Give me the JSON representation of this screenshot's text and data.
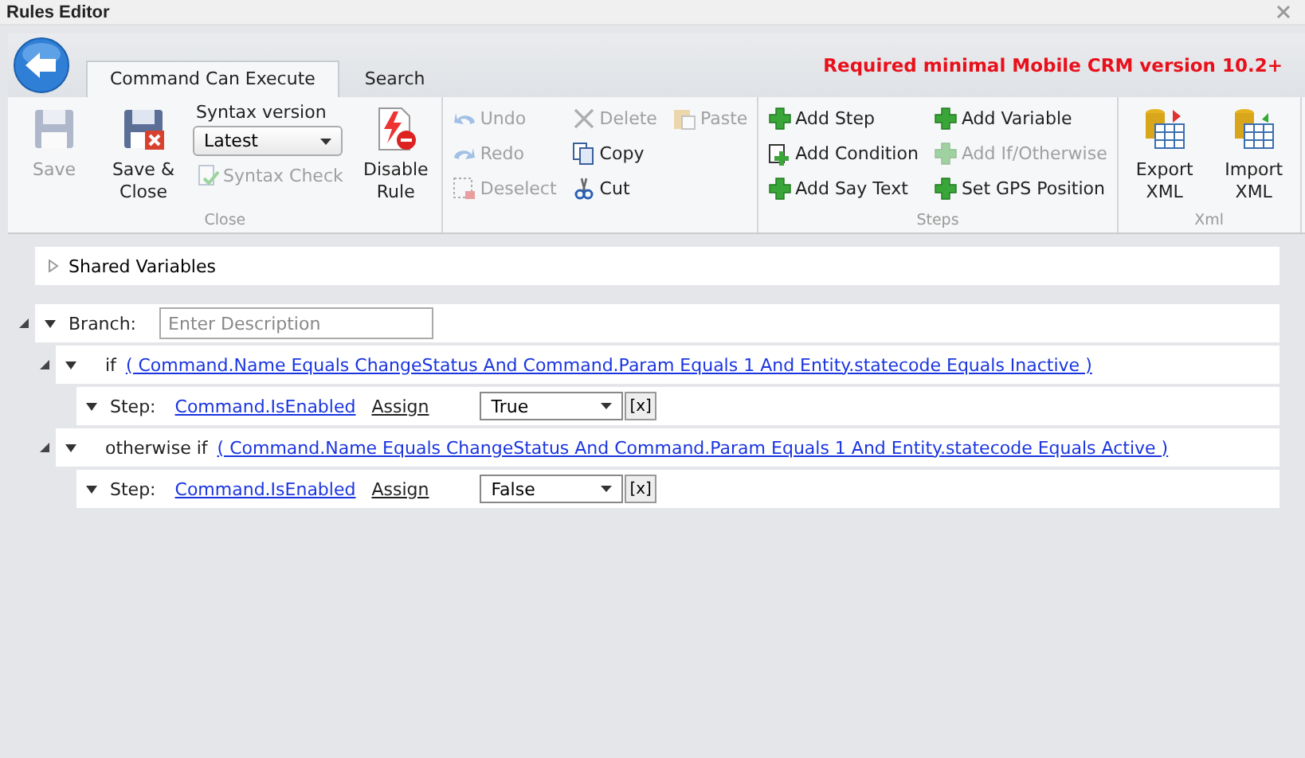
{
  "window": {
    "title": "Rules Editor"
  },
  "tabs": [
    {
      "label": "Command Can Execute",
      "selected": true
    },
    {
      "label": "Search",
      "selected": false
    }
  ],
  "notice": "Required minimal Mobile CRM version 10.2+",
  "ribbon_groups": [
    {
      "label": "Close",
      "columns": [
        [
          {
            "kind": "large",
            "label": "Save",
            "disabled": true
          }
        ],
        [
          {
            "kind": "large",
            "label": "Save & Close",
            "disabled": false
          }
        ],
        [
          {
            "kind": "caption",
            "label": "Syntax version"
          },
          {
            "kind": "select",
            "value": "Latest"
          },
          {
            "kind": "small",
            "label": "Syntax Check",
            "disabled": true
          }
        ],
        [
          {
            "kind": "large",
            "label": "Disable Rule",
            "disabled": false
          }
        ]
      ]
    },
    {
      "columns": [
        [
          {
            "kind": "small",
            "label": "Undo",
            "disabled": true
          },
          {
            "kind": "small",
            "label": "Redo",
            "disabled": true
          },
          {
            "kind": "small",
            "label": "Deselect",
            "disabled": true
          }
        ],
        [
          {
            "kind": "small",
            "label": "Delete",
            "disabled": true
          },
          {
            "kind": "small",
            "label": "Copy",
            "disabled": false
          },
          {
            "kind": "small",
            "label": "Cut",
            "disabled": false
          }
        ],
        [
          {
            "kind": "small",
            "label": "Paste",
            "disabled": true
          }
        ]
      ]
    },
    {
      "label": "Steps",
      "columns": [
        [
          {
            "kind": "small",
            "label": "Add Step",
            "disabled": false
          },
          {
            "kind": "small",
            "label": "Add Condition",
            "disabled": false
          },
          {
            "kind": "small",
            "label": "Add Say Text",
            "disabled": false
          }
        ],
        [
          {
            "kind": "small",
            "label": "Add Variable",
            "disabled": false
          },
          {
            "kind": "small",
            "label": "Add If/Otherwise",
            "disabled": true
          },
          {
            "kind": "small",
            "label": "Set GPS Position",
            "disabled": false
          }
        ]
      ]
    },
    {
      "label": "Xml",
      "columns": [
        [
          {
            "kind": "large",
            "label": "Export XML",
            "disabled": false
          }
        ],
        [
          {
            "kind": "large",
            "label": "Import XML",
            "disabled": false
          }
        ]
      ]
    }
  ],
  "shared_variables": {
    "label": "Shared Variables",
    "expanded": false
  },
  "tree": [
    {
      "kind": "branch",
      "label": "Branch:",
      "placeholder": "Enter Description",
      "expanded": true,
      "children": [
        {
          "kind": "condition",
          "keyword": "if",
          "expression": "( Command.Name Equals ChangeStatus And Command.Param Equals 1 And Entity.statecode Equals Inactive )",
          "expanded": true,
          "children": [
            {
              "kind": "step",
              "label": "Step:",
              "target": "Command.IsEnabled",
              "action": "Assign",
              "value": "True",
              "clear_label": "[x]",
              "expanded": true
            }
          ]
        },
        {
          "kind": "condition",
          "keyword": "otherwise if",
          "expression": "( Command.Name Equals ChangeStatus And Command.Param Equals 1 And Entity.statecode Equals Active )",
          "expanded": true,
          "children": [
            {
              "kind": "step",
              "label": "Step:",
              "target": "Command.IsEnabled",
              "action": "Assign",
              "value": "False",
              "clear_label": "[x]",
              "expanded": true
            }
          ]
        }
      ]
    }
  ]
}
